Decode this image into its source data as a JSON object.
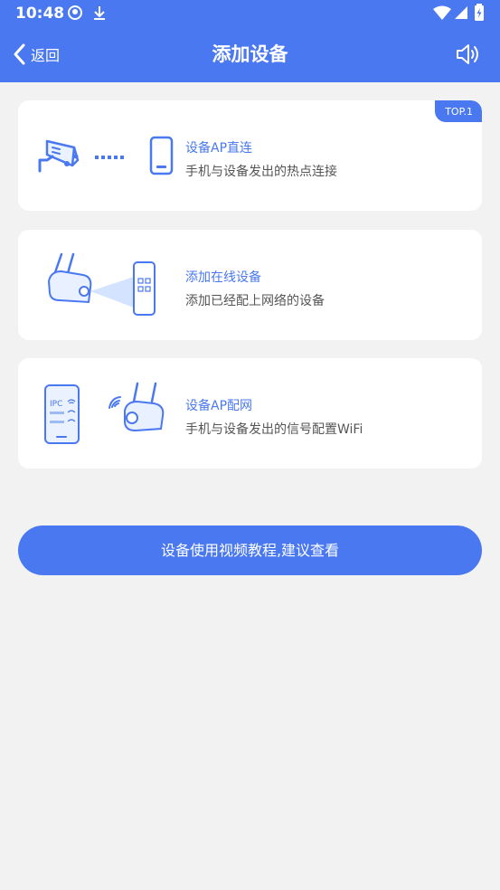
{
  "status_bar": {
    "time": "10:48"
  },
  "nav": {
    "back_label": "返回",
    "title": "添加设备"
  },
  "cards": [
    {
      "title": "设备AP直连",
      "subtitle": "手机与设备发出的热点连接",
      "badge": "TOP.1"
    },
    {
      "title": "添加在线设备",
      "subtitle": "添加已经配上网络的设备"
    },
    {
      "title": "设备AP配网",
      "subtitle": "手机与设备发出的信号配置WiFi",
      "phone_label": "IPC"
    }
  ],
  "tutorial_button": {
    "label": "设备使用视频教程,建议查看"
  },
  "colors": {
    "primary": "#4a78f0",
    "background": "#f2f2f2",
    "card": "#ffffff"
  }
}
